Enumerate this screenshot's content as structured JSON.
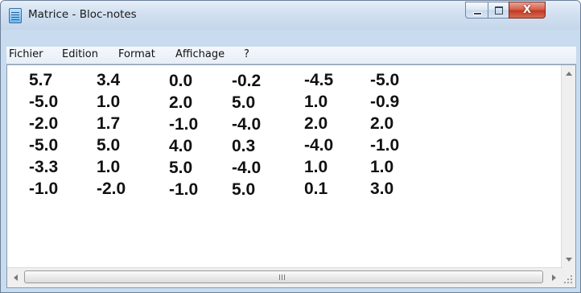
{
  "window": {
    "title": "Matrice - Bloc-notes",
    "controls": {
      "minimize": "",
      "maximize": "",
      "close": "X"
    }
  },
  "menu": {
    "items": [
      {
        "label": "Fichier"
      },
      {
        "label": "Edition"
      },
      {
        "label": "Format"
      },
      {
        "label": "Affichage"
      },
      {
        "label": "?"
      }
    ]
  },
  "document": {
    "rows": [
      [
        "5.7",
        "3.4",
        "0.0",
        "-0.2",
        "-4.5",
        "-5.0"
      ],
      [
        "-5.0",
        "1.0",
        "2.0",
        "5.0",
        "1.0",
        "-0.9"
      ],
      [
        "-2.0",
        "1.7",
        "-1.0",
        "-4.0",
        "2.0",
        "2.0"
      ],
      [
        "-5.0",
        "5.0",
        "4.0",
        "0.3",
        "-4.0",
        "-1.0"
      ],
      [
        "-3.3",
        "1.0",
        "5.0",
        "-4.0",
        "1.0",
        "1.0"
      ],
      [
        "-1.0",
        "-2.0",
        "-1.0",
        "5.0",
        "0.1",
        "3.0"
      ]
    ]
  },
  "icons": {
    "app": "notepad-icon",
    "minimize": "minimize-icon",
    "maximize": "maximize-icon",
    "close": "close-icon",
    "scroll_up": "scroll-up-arrow-icon",
    "scroll_down": "scroll-down-arrow-icon",
    "scroll_left": "scroll-left-arrow-icon",
    "scroll_right": "scroll-right-arrow-icon"
  },
  "colors": {
    "title_bar": "#d3e1f1",
    "close_button": "#c13a24",
    "text": "#111111"
  }
}
